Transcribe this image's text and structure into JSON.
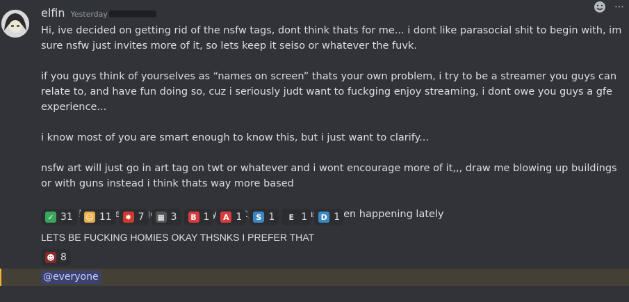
{
  "message": {
    "username": "elfin",
    "timestamp": "Yesterday",
    "paragraphs": [
      "Hi, ive decided on getting rid of the nsfw tags, dont think thats for me... i dont like parasocial shit to begin with, im sure nsfw just invites more of it, so lets keep it seiso or whatever the fuvk.",
      "if you guys think of yourselves as “names on screen” thats your own problem, i try to be a streamer you guys can relate to, and have fun doing so, cuz i seriously judt want to fuckging enjoy streaming, i dont owe you guys a gfe experience...",
      "i know most of you are smart enough to know this, but i just want to clarify...",
      "nsfw art will just go in art tag on twt or whatever and i wont encourage more of it,,, draw me blowing up buildings or with guns instead i think thats way more based",
      "thanks !! needed to get this off my chest, after shit thsts been happening lately"
    ],
    "reactions": [
      {
        "icon": "check-emoji",
        "glyph": "✓",
        "color": "#3ba55d",
        "count": "31"
      },
      {
        "icon": "angel-emoji",
        "glyph": "☺",
        "color": "#e8b04a",
        "count": "11"
      },
      {
        "icon": "explosion-emoji",
        "glyph": "✸",
        "color": "#d0392b",
        "count": "7"
      },
      {
        "icon": "custom-image-emoji",
        "glyph": "▦",
        "color": "#555555",
        "count": "3"
      },
      {
        "icon": "letter-b-emoji",
        "glyph": "B",
        "color": "#d83c3e",
        "count": "1"
      },
      {
        "icon": "letter-a-emoji",
        "glyph": "A",
        "color": "#d83c3e",
        "count": "1"
      },
      {
        "icon": "letter-s-emoji",
        "glyph": "S",
        "color": "#3b88c3",
        "count": "1"
      },
      {
        "icon": "letter-e-emoji",
        "glyph": "E",
        "color": "#2b2d31",
        "count": "1"
      },
      {
        "icon": "letter-d-emoji",
        "glyph": "D",
        "color": "#3b88c3",
        "count": "1"
      }
    ],
    "second_line": "LETS BE FUCKING HOMIES OKAY THSNKS I PREFER THAT",
    "second_reactions": [
      {
        "icon": "custom-face-emoji",
        "glyph": "☻",
        "color": "#8a2a2a",
        "count": "8"
      }
    ],
    "mention": "@everyone"
  },
  "colors": {
    "background": "#313338",
    "mention_highlight": "#444036",
    "mention_bar": "#f0b232",
    "mention_pill": "#3c4270"
  }
}
